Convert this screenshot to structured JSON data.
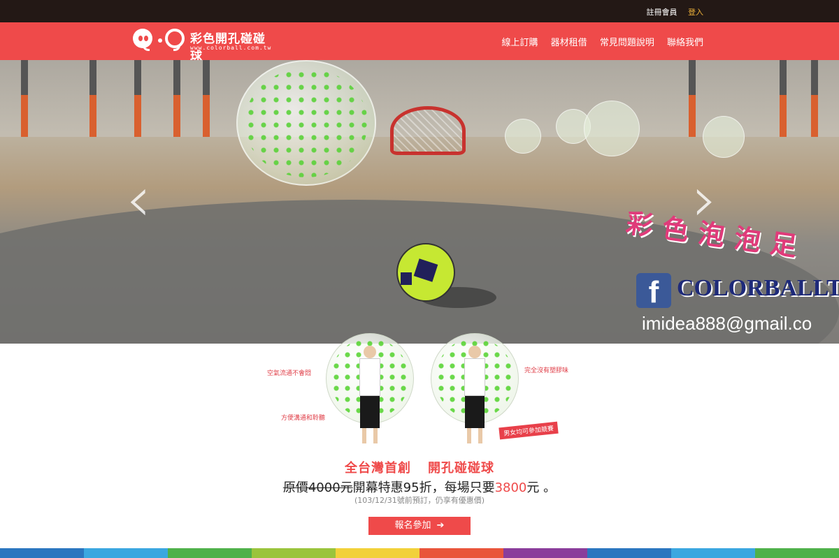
{
  "topbar": {
    "register": "註冊會員",
    "login": "登入"
  },
  "brand": {
    "name": "彩色開孔碰碰球",
    "url": "www.colorball.com.tw"
  },
  "nav": {
    "items": [
      "線上訂購",
      "器材租借",
      "常見問題說明",
      "聯絡我們"
    ]
  },
  "hero": {
    "prev_icon": "chevron-left-icon",
    "next_icon": "chevron-right-icon",
    "overlay_title": "彩色泡泡足",
    "facebook_name": "COLORBALLTW",
    "email": "imidea888@gmail.co"
  },
  "promo": {
    "callouts": [
      "空氣流通不會悶",
      "方便溝通和聆聽",
      "完全沒有塑膠味"
    ],
    "tag": "男女均可參加競賽",
    "headline_a": "全台灣首創",
    "headline_b": "開孔碰碰球",
    "price_old": "原價4000元",
    "price_mid": "開幕特惠95折，每場只要",
    "price_new": "3800",
    "price_end": "元 。",
    "note": "(103/12/31號前預訂，仍享有優惠價)",
    "cta": "報名參加"
  },
  "colors": {
    "accent": "#ef4a4a",
    "topbar": "#231815",
    "login": "#f0b33a",
    "stripe": [
      "#2b76bf",
      "#3ba7e0",
      "#4fb14a",
      "#9ac43c",
      "#f2d13a",
      "#e9553b",
      "#8a3d9b",
      "#2b76bf",
      "#3ba7e0",
      "#4fb14a"
    ]
  }
}
